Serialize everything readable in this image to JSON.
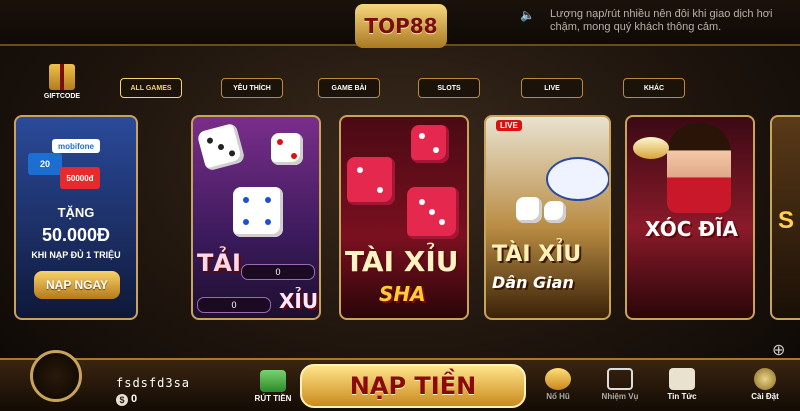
{
  "header": {
    "logo": "TOP88",
    "notice": "Lượng nạp/rút nhiều nên đôi khi giao dịch hơi chậm, mong quý khách thông cảm."
  },
  "giftcode": {
    "label": "GIFTCODE"
  },
  "categories": [
    {
      "label": "ALL GAMES",
      "active": true
    },
    {
      "label": "YÊU THÍCH",
      "active": false
    },
    {
      "label": "GAME BÀI",
      "active": false
    },
    {
      "label": "SLOTS",
      "active": false
    },
    {
      "label": "LIVE",
      "active": false
    },
    {
      "label": "KHÁC",
      "active": false
    }
  ],
  "promo": {
    "cards": [
      "20",
      "50000đ"
    ],
    "brand": "mobifone",
    "line1": "TẶNG",
    "amount": "50.000Đ",
    "condition": "KHI NẠP ĐỦ 1 TRIỆU",
    "button": "NẠP NGAY"
  },
  "games": {
    "taixiu": {
      "tai": "TẢI",
      "xiu": "XỈU",
      "score_tai": "0",
      "score_xiu": "0"
    },
    "taixiu_sha": {
      "title": "TÀI XỈU",
      "sub": "SHA"
    },
    "taixiu_dangian": {
      "live": "LIVE",
      "title": "TÀI XỈU",
      "sub": "Dân Gian"
    },
    "xocdia": {
      "title": "XÓC ĐĨA"
    },
    "partial": {
      "text": "S"
    }
  },
  "bottom": {
    "username": "fsdsfd3sa",
    "coin_symbol": "$",
    "balance": "0",
    "withdraw": "RÚT TIỀN",
    "deposit": "NẠP TIỀN",
    "nav": [
      "Nổ Hũ",
      "Nhiệm Vụ",
      "Tin Tức",
      "Cài Đặt"
    ]
  }
}
